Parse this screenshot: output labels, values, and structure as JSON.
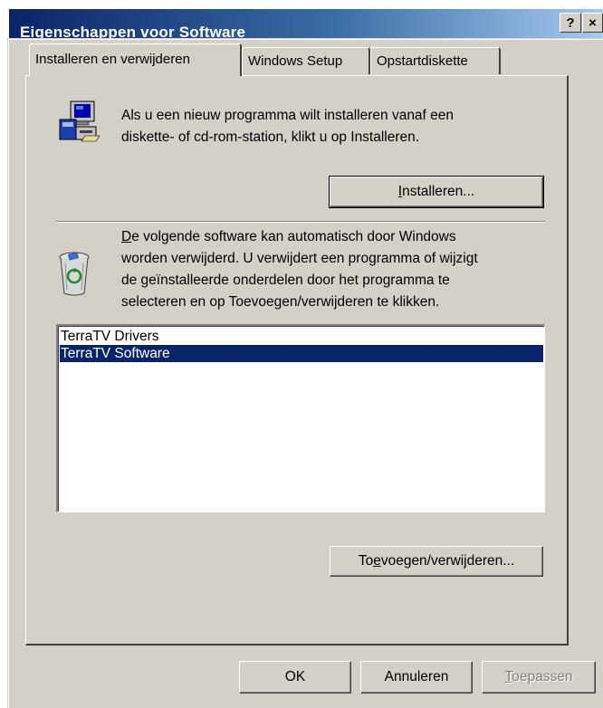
{
  "window": {
    "title": "Eigenschappen voor Software",
    "help_label": "?",
    "close_label": "×"
  },
  "tabs": [
    {
      "label": "Installeren en verwijderen",
      "active": true
    },
    {
      "label": "Windows Setup",
      "active": false
    },
    {
      "label": "Opstartdiskette",
      "active": false
    }
  ],
  "install_section": {
    "icon": "computer-install-icon",
    "line1": "Als u een nieuw programma wilt installeren vanaf een",
    "line2": "diskette- of cd-rom-station, klikt u op Installeren.",
    "button_pre": "",
    "button_mnemonic": "I",
    "button_post": "nstalleren..."
  },
  "remove_section": {
    "icon": "recycle-bin-icon",
    "line1_mnemonic": "D",
    "line1_rest": "e volgende software kan automatisch door Windows",
    "line2": "worden verwijderd. U verwijdert een programma of wijzigt",
    "line3": "de geïnstalleerde onderdelen door het programma te",
    "line4": "selecteren en op Toevoegen/verwijderen te klikken."
  },
  "software_list": {
    "items": [
      {
        "label": "TerraTV Drivers",
        "selected": false
      },
      {
        "label": "TerraTV Software",
        "selected": true
      }
    ]
  },
  "add_remove_button": {
    "pre": "To",
    "mnemonic": "e",
    "post": "voegen/verwijderen..."
  },
  "footer": {
    "ok_label": "OK",
    "cancel_label": "Annuleren",
    "apply_mnemonic": "T",
    "apply_post": "oepassen"
  },
  "colors": {
    "titlebar_start": "#0a246a",
    "titlebar_end": "#a6caf0",
    "face": "#d4d0c8",
    "selection": "#0a246a"
  }
}
